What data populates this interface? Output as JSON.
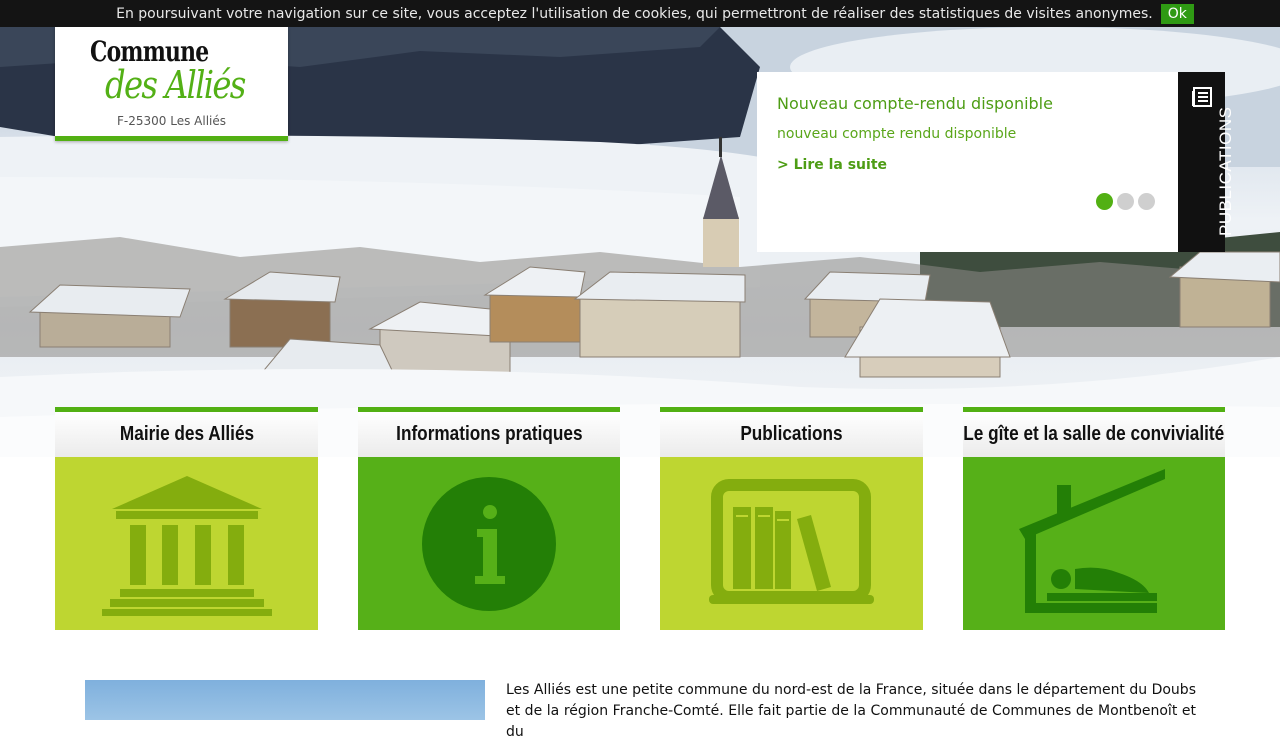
{
  "cookie": {
    "message": "En poursuivant votre navigation sur ce site, vous acceptez l'utilisation de cookies, qui permettront de réaliser des statistiques de visites anonymes.",
    "ok_label": "Ok"
  },
  "logo": {
    "line1": "Commune",
    "line2": "des Alliés",
    "address": "F-25300 Les Alliés"
  },
  "news": {
    "title": "Nouveau compte-rendu disponible",
    "description": "nouveau compte rendu disponible",
    "read_more": "> Lire la suite",
    "tab_label": "PUBLICATIONS",
    "slides": [
      true,
      false,
      false
    ]
  },
  "tiles": [
    {
      "label": "Mairie des Alliés",
      "icon": "town-hall-icon"
    },
    {
      "label": "Informations pratiques",
      "icon": "info-icon"
    },
    {
      "label": "Publications",
      "icon": "books-icon"
    },
    {
      "label": "Le gîte et la salle de convivialité",
      "icon": "lodging-icon"
    }
  ],
  "intro": {
    "text": "Les Alliés est une petite commune du nord-est de la France, située dans le département du Doubs et de la région Franche-Comté. Elle fait partie de la Communauté de Communes de Montbenoît et du"
  },
  "colors": {
    "green_accent": "#52b013",
    "tile_light": "#bed631",
    "tile_dark": "#56b018"
  }
}
